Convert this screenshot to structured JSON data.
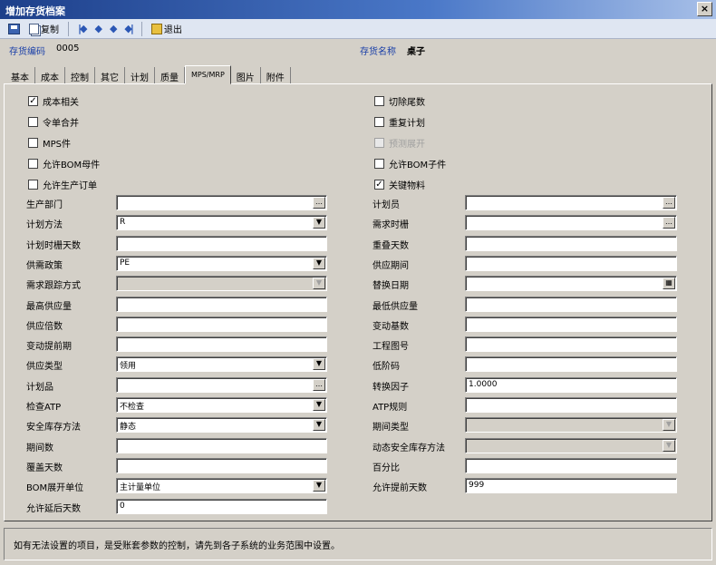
{
  "window": {
    "title": "增加存货档案",
    "close_label": "×"
  },
  "toolbar": {
    "copy_label": "复制",
    "exit_label": "退出"
  },
  "header": {
    "code_label": "存货编码",
    "code_value": "0005",
    "name_label": "存货名称",
    "name_value": "桌子"
  },
  "tabs": [
    "基本",
    "成本",
    "控制",
    "其它",
    "计划",
    "质量",
    "MPS/MRP",
    "图片",
    "附件"
  ],
  "active_tab": "MPS/MRP",
  "checkboxes_left": [
    {
      "label": "成本相关",
      "checked": true
    },
    {
      "label": "令单合并",
      "checked": false
    },
    {
      "label": "MPS件",
      "checked": false
    },
    {
      "label": "允许BOM母件",
      "checked": false
    },
    {
      "label": "允许生产订单",
      "checked": false
    }
  ],
  "checkboxes_right": [
    {
      "label": "切除尾数",
      "checked": false,
      "disabled": false
    },
    {
      "label": "重复计划",
      "checked": false,
      "disabled": false
    },
    {
      "label": "预测展开",
      "checked": false,
      "disabled": true
    },
    {
      "label": "允许BOM子件",
      "checked": false,
      "disabled": false
    },
    {
      "label": "关键物料",
      "checked": true,
      "disabled": false
    }
  ],
  "fields_left": [
    {
      "label": "生产部门",
      "value": "",
      "ctrl": "ref"
    },
    {
      "label": "计划方法",
      "value": "R",
      "ctrl": "dropdown"
    },
    {
      "label": "计划时栅天数",
      "value": "",
      "ctrl": "text"
    },
    {
      "label": "供需政策",
      "value": "PE",
      "ctrl": "dropdown"
    },
    {
      "label": "需求跟踪方式",
      "value": "",
      "ctrl": "dropdown-disabled"
    },
    {
      "label": "最高供应量",
      "value": "",
      "ctrl": "text"
    },
    {
      "label": "供应倍数",
      "value": "",
      "ctrl": "text"
    },
    {
      "label": "变动提前期",
      "value": "",
      "ctrl": "text"
    },
    {
      "label": "供应类型",
      "value": "领用",
      "ctrl": "dropdown"
    },
    {
      "label": "计划品",
      "value": "",
      "ctrl": "ref"
    },
    {
      "label": "检查ATP",
      "value": "不检查",
      "ctrl": "dropdown"
    },
    {
      "label": "安全库存方法",
      "value": "静态",
      "ctrl": "dropdown"
    },
    {
      "label": "期间数",
      "value": "",
      "ctrl": "text"
    },
    {
      "label": "覆盖天数",
      "value": "",
      "ctrl": "text"
    },
    {
      "label": "BOM展开单位",
      "value": "主计量单位",
      "ctrl": "dropdown"
    },
    {
      "label": "允许延后天数",
      "value": "0",
      "ctrl": "text"
    }
  ],
  "fields_right": [
    {
      "label": "计划员",
      "value": "",
      "ctrl": "ref"
    },
    {
      "label": "需求时栅",
      "value": "",
      "ctrl": "ref"
    },
    {
      "label": "重叠天数",
      "value": "",
      "ctrl": "text"
    },
    {
      "label": "供应期间",
      "value": "",
      "ctrl": "text"
    },
    {
      "label": "替换日期",
      "value": "",
      "ctrl": "date"
    },
    {
      "label": "最低供应量",
      "value": "",
      "ctrl": "text"
    },
    {
      "label": "变动基数",
      "value": "",
      "ctrl": "text"
    },
    {
      "label": "工程图号",
      "value": "",
      "ctrl": "text"
    },
    {
      "label": "低阶码",
      "value": "",
      "ctrl": "text"
    },
    {
      "label": "转换因子",
      "value": "1.0000",
      "ctrl": "text"
    },
    {
      "label": "ATP规则",
      "value": "",
      "ctrl": "text"
    },
    {
      "label": "期间类型",
      "value": "",
      "ctrl": "dropdown-disabled"
    },
    {
      "label": "动态安全库存方法",
      "value": "",
      "ctrl": "dropdown-disabled"
    },
    {
      "label": "百分比",
      "value": "",
      "ctrl": "text"
    },
    {
      "label": "允许提前天数",
      "value": "999",
      "ctrl": "text"
    }
  ],
  "status_message": "如有无法设置的项目，是受账套参数的控制，请先到各子系统的业务范围中设置。"
}
